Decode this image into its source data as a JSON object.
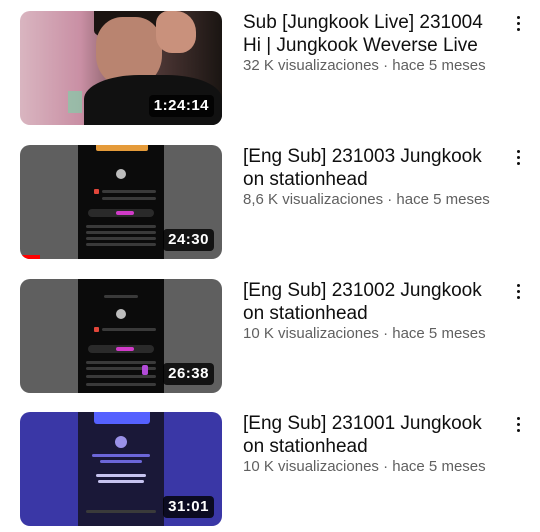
{
  "videos": [
    {
      "title": "Sub [Jungkook Live] 231004 Hi | Jungkook Weverse Live",
      "meta": "32 K visualizaciones · hace 5 meses",
      "duration": "1:24:14",
      "watched_fraction": 0
    },
    {
      "title": "[Eng Sub] 231003 Jungkook on stationhead",
      "meta": "8,6 K visualizaciones · hace 5 meses",
      "duration": "24:30",
      "watched_fraction": 0.1
    },
    {
      "title": "[Eng Sub] 231002 Jungkook on stationhead",
      "meta": "10 K visualizaciones · hace 5 meses",
      "duration": "26:38",
      "watched_fraction": 0
    },
    {
      "title": "[Eng Sub] 231001 Jungkook on stationhead",
      "meta": "10 K visualizaciones · hace 5 meses",
      "duration": "31:01",
      "watched_fraction": 0
    }
  ],
  "colors": {
    "progress": "#ff0000",
    "thumb_gray": "#5f5f5f",
    "thumb_purple": "#3a37a6"
  }
}
